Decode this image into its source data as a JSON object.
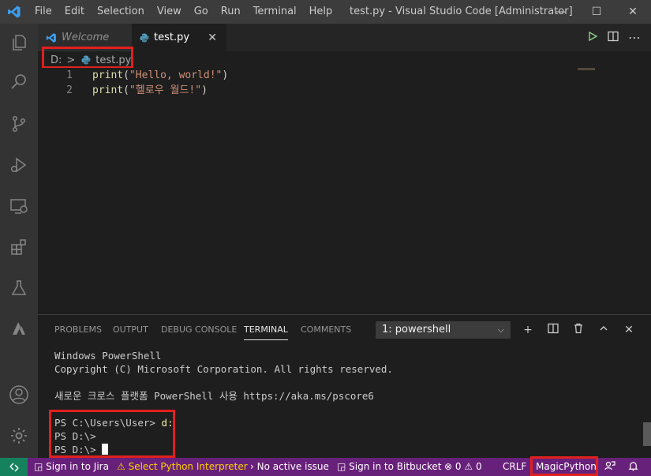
{
  "titlebar": {
    "menu": [
      "File",
      "Edit",
      "Selection",
      "View",
      "Go",
      "Run",
      "Terminal",
      "Help"
    ],
    "title": "test.py - Visual Studio Code [Administrator]",
    "minimize": "—",
    "maximize": "☐",
    "close": "✕"
  },
  "activitybar": {
    "icons": [
      "explorer-icon",
      "search-icon",
      "source-control-icon",
      "run-debug-icon",
      "remote-explorer-icon",
      "extensions-icon",
      "testing-icon",
      "azure-icon",
      "account-icon",
      "settings-gear-icon"
    ]
  },
  "tabs": {
    "welcome": "Welcome",
    "active": "test.py",
    "close": "✕"
  },
  "breadcrumb": {
    "drive": "D:",
    "separator": ">",
    "file": "test.py"
  },
  "editor": {
    "lines": [
      {
        "num": "1",
        "fn": "print",
        "open": "(",
        "str": "\"Hello, world!\"",
        "close": ")"
      },
      {
        "num": "2",
        "fn": "print",
        "open": "(",
        "str": "\"헬로우 월드!\"",
        "close": ")"
      }
    ]
  },
  "panel": {
    "tabs": [
      "PROBLEMS",
      "OUTPUT",
      "DEBUG CONSOLE",
      "TERMINAL",
      "COMMENTS"
    ],
    "active_tab": "TERMINAL",
    "terminal_select": "1: powershell",
    "terminal_lines": {
      "l1": "Windows PowerShell",
      "l2": "Copyright (C) Microsoft Corporation. All rights reserved.",
      "l3": "새로운 크로스 플랫폼 PowerShell 사용 https://aka.ms/pscore6",
      "l4_prompt": "PS C:\\Users\\User> ",
      "l4_cmd": "d:",
      "l5": "PS D:\\>",
      "l6": "PS D:\\> "
    }
  },
  "statusbar": {
    "jira": "Sign in to Jira",
    "python": "Select Python Interpreter",
    "issue": "No active issue",
    "bitbucket": "Sign in to Bitbucket",
    "errors": "0",
    "warnings": "0",
    "eol": "CRLF",
    "language": "MagicPython"
  },
  "colors": {
    "statusbar": "#68217a",
    "remote": "#16825d",
    "highlight_box": "#e0201e",
    "accent": "#0078d4"
  }
}
